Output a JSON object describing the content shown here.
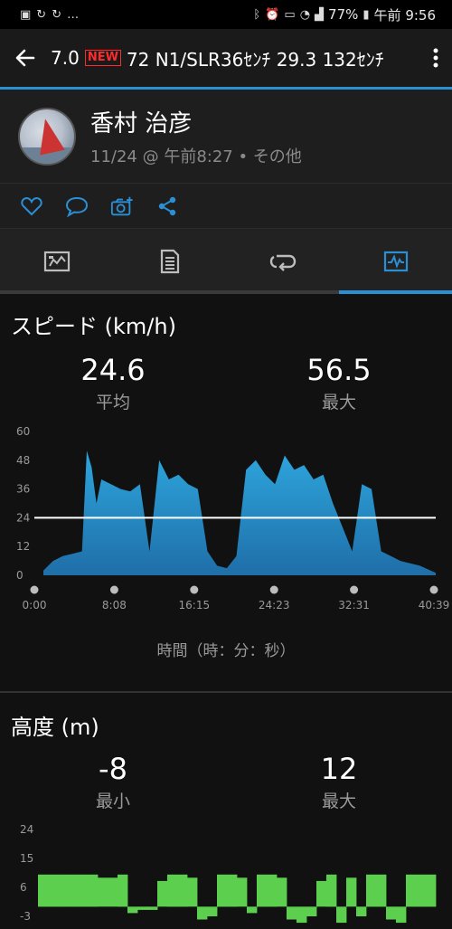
{
  "status_bar": {
    "left_icons": [
      "image-icon",
      "sync-icon",
      "sync-icon",
      "more-dots"
    ],
    "battery": "77%",
    "time": "午前 9:56"
  },
  "app_bar": {
    "title_pre": "7.0",
    "new_badge": "NEW",
    "title_post": "72 N1/SLR36ｾﾝﾁ 29.3 132ｾﾝﾁ"
  },
  "profile": {
    "name": "香村 治彦",
    "meta": "11/24 @ 午前8:27 • その他"
  },
  "actions": [
    "like-icon",
    "comment-icon",
    "add-photo-icon",
    "share-icon"
  ],
  "tabs": [
    {
      "name": "summary",
      "active": false
    },
    {
      "name": "details",
      "active": false
    },
    {
      "name": "laps",
      "active": false
    },
    {
      "name": "charts",
      "active": true
    }
  ],
  "speed": {
    "title": "スピード (km/h)",
    "avg_value": "24.6",
    "avg_label": "平均",
    "max_value": "56.5",
    "max_label": "最大",
    "time_caption": "時間（時：分：秒）"
  },
  "elevation": {
    "title": "高度 (m)",
    "min_value": "-8",
    "min_label": "最小",
    "max_value": "12",
    "max_label": "最大"
  },
  "colors": {
    "accent": "#2b8fd4",
    "speed_fill_top": "#2ea6dd",
    "speed_fill_bottom": "#1f6ea8",
    "elev_fill": "#5ccf4e"
  },
  "chart_data": [
    {
      "type": "area",
      "title": "スピード (km/h)",
      "ylim": [
        0,
        60
      ],
      "yticks": [
        "60",
        "48",
        "36",
        "24",
        "12",
        "0"
      ],
      "xticks": [
        "0:00",
        "8:08",
        "16:15",
        "24:23",
        "32:31",
        "40:39"
      ],
      "reference_line": 24,
      "x_minutes": [
        0,
        1,
        2,
        3,
        4,
        4.5,
        5,
        5.5,
        6,
        7,
        8,
        9,
        10,
        11,
        12,
        12.5,
        13,
        14,
        15,
        16,
        17,
        18,
        19,
        20,
        21,
        22,
        23,
        24,
        25,
        26,
        27,
        28,
        29,
        30,
        31,
        32,
        33,
        34,
        35,
        36,
        37,
        38,
        39,
        40.65
      ],
      "values": [
        2,
        6,
        8,
        9,
        10,
        52,
        45,
        30,
        40,
        38,
        36,
        35,
        38,
        10,
        48,
        44,
        40,
        42,
        38,
        36,
        10,
        4,
        3,
        8,
        44,
        48,
        42,
        38,
        50,
        44,
        46,
        40,
        42,
        30,
        20,
        10,
        38,
        36,
        10,
        8,
        6,
        5,
        4,
        1
      ]
    },
    {
      "type": "area",
      "title": "高度 (m)",
      "ylim": [
        -3,
        24
      ],
      "yticks": [
        "24",
        "15",
        "6",
        "-3"
      ],
      "x_minutes": [
        0,
        2,
        4,
        6,
        8,
        9,
        10,
        12,
        13,
        14,
        15,
        16,
        17,
        18,
        19,
        20,
        21,
        22,
        23,
        24,
        25,
        26,
        27,
        28,
        29,
        30,
        31,
        32,
        33,
        34,
        35,
        36,
        37,
        38,
        39,
        40
      ],
      "values": [
        10,
        10,
        10,
        9,
        10,
        -2,
        -1,
        8,
        10,
        10,
        9,
        -4,
        -3,
        10,
        10,
        9,
        -2,
        10,
        10,
        9,
        -4,
        -5,
        -3,
        8,
        10,
        -5,
        9,
        -3,
        10,
        10,
        -4,
        -5,
        10,
        10,
        10,
        10
      ]
    }
  ]
}
